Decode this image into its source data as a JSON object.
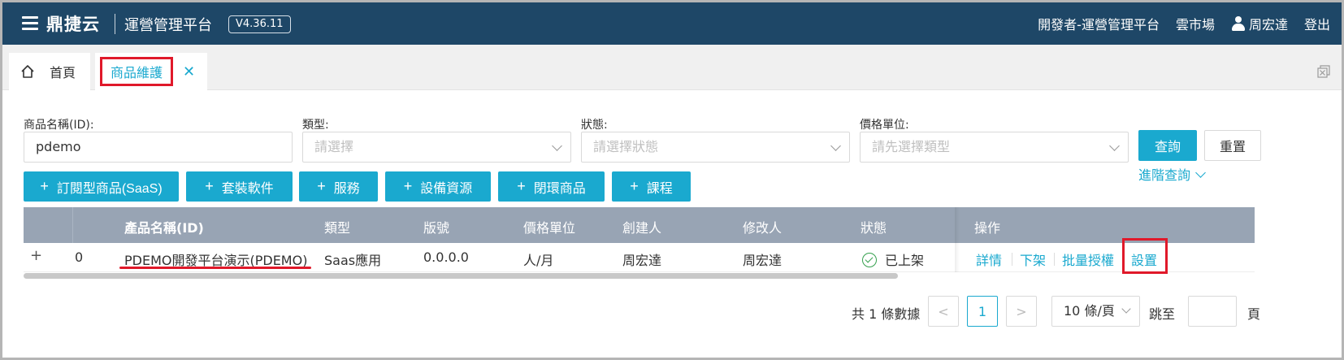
{
  "header": {
    "brand": "鼎捷云",
    "platform": "運營管理平台",
    "version": "V4.36.11",
    "nav": {
      "developer": "開發者-運營管理平台",
      "marketplace": "雲市場",
      "user": "周宏達",
      "logout": "登出"
    }
  },
  "tabs": {
    "home": "首頁",
    "product": "商品維護"
  },
  "filters": {
    "name_label": "商品名稱(ID):",
    "name_value": "pdemo",
    "type_label": "類型:",
    "type_placeholder": "請選擇",
    "status_label": "狀態:",
    "status_placeholder": "請選擇狀態",
    "price_label": "價格單位:",
    "price_placeholder": "請先選擇類型",
    "query": "查詢",
    "reset": "重置",
    "advanced": "進階查詢"
  },
  "add_buttons": [
    "訂閱型商品(SaaS)",
    "套裝軟件",
    "服務",
    "設備資源",
    "閉環商品",
    "課程"
  ],
  "table": {
    "headers": {
      "name": "產品名稱(ID)",
      "type": "類型",
      "version": "版號",
      "price_unit": "價格單位",
      "creator": "創建人",
      "modifier": "修改人",
      "status": "狀態",
      "actions": "操作"
    },
    "rows": [
      {
        "expand": "+",
        "index": "0",
        "name": "PDEMO開發平台演示(PDEMO)",
        "type": "Saas應用",
        "version": "0.0.0.0",
        "price_unit": "人/月",
        "creator": "周宏達",
        "modifier": "周宏達",
        "status": "已上架",
        "actions": [
          "詳情",
          "下架",
          "批量授權",
          "設置"
        ]
      }
    ]
  },
  "pagination": {
    "total": "共 1 條數據",
    "prev": "<",
    "current": "1",
    "next": ">",
    "page_size": "10 條/頁",
    "jump_label": "跳至",
    "page_suffix": "頁"
  },
  "colors": {
    "header_bg": "#1e4767",
    "accent": "#1aa9cf",
    "table_header_bg": "#98a4b4",
    "highlight": "#e0192a",
    "status_ok": "#35a04e"
  }
}
